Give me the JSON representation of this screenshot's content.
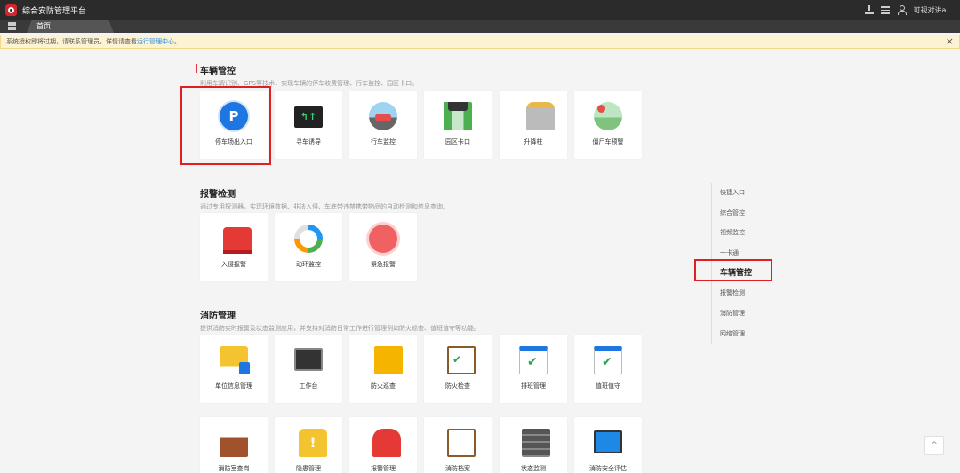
{
  "header": {
    "app_title": "综合安防管理平台",
    "user_name": "可视对讲a...",
    "home_tab": "首页",
    "icons": [
      "download-icon",
      "menu-icon",
      "user-icon",
      "grid-icon"
    ]
  },
  "notice": {
    "text": "系统授权即将过期，请联系管理员，详情请查看",
    "link": "运行管理中心",
    "suffix": "。",
    "close": "×"
  },
  "sections": {
    "vehicle": {
      "title": "车辆管控",
      "desc": "利用车牌识别、GPS等技术，实现车辆的停车收费管理、行车监控、园区卡口。",
      "items": [
        {
          "label": "停车场出入口",
          "icon": "parking-icon",
          "symbol": "P"
        },
        {
          "label": "寻车诱导",
          "icon": "guide-icon",
          "symbol": "↰↑"
        },
        {
          "label": "行车监控",
          "icon": "traffic-monitor-icon"
        },
        {
          "label": "园区卡口",
          "icon": "park-gate-icon"
        },
        {
          "label": "升降柱",
          "icon": "lift-post-icon"
        },
        {
          "label": "僵尸车预警",
          "icon": "zombie-car-icon"
        }
      ]
    },
    "alarm": {
      "title": "报警检测",
      "desc": "通过专用探测器，实现环境数据、非法入侵、车底带违禁携带物品的自动检测和信息查询。",
      "items": [
        {
          "label": "入侵报警",
          "icon": "intrusion-alarm-icon"
        },
        {
          "label": "动环监控",
          "icon": "environment-monitor-icon"
        },
        {
          "label": "紧急报警",
          "icon": "emergency-alarm-icon"
        }
      ]
    },
    "fire": {
      "title": "消防管理",
      "desc": "提供消防实时报警及状态监测应用，并支持对消防日常工作进行管理例如防火巡查、值班值守等功能。",
      "items": [
        {
          "label": "单位信息管理",
          "icon": "unit-info-icon"
        },
        {
          "label": "工作台",
          "icon": "workbench-icon"
        },
        {
          "label": "防火巡查",
          "icon": "fire-patrol-icon"
        },
        {
          "label": "防火检查",
          "icon": "fire-check-icon"
        },
        {
          "label": "排班管理",
          "icon": "schedule-icon"
        },
        {
          "label": "值班值守",
          "icon": "duty-icon"
        },
        {
          "label": "消防室查岗",
          "icon": "control-room-icon"
        },
        {
          "label": "隐患管理",
          "icon": "hazard-icon",
          "symbol": "!"
        },
        {
          "label": "报警管理",
          "icon": "alarm-management-icon"
        },
        {
          "label": "消防档案",
          "icon": "fire-archive-icon"
        },
        {
          "label": "状态监测",
          "icon": "status-monitor-icon"
        },
        {
          "label": "消防安全评估",
          "icon": "safety-evaluation-icon"
        }
      ]
    }
  },
  "quick_nav": {
    "items": [
      "快捷入口",
      "综合管控",
      "视频监控",
      "一卡通",
      "车辆管控",
      "报警检测",
      "消防管理",
      "网络管理"
    ],
    "active_index": 4
  },
  "scroll_top": "^",
  "colors": {
    "accent": "#1e77e0",
    "highlight": "#e02020",
    "topbar": "#2b2b2b"
  }
}
